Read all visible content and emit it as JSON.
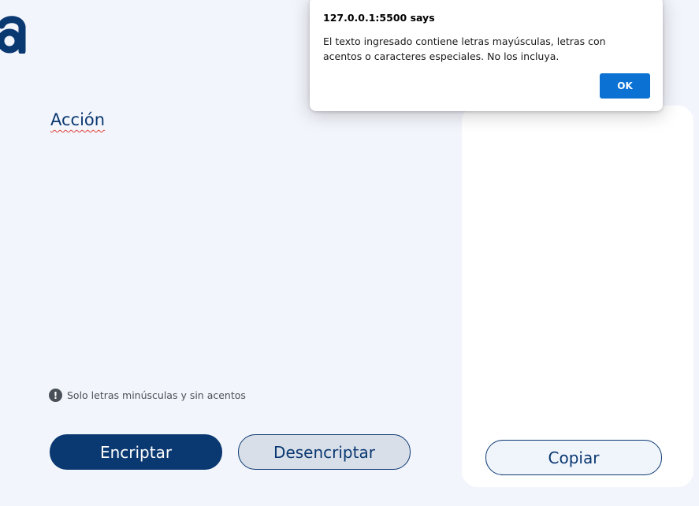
{
  "app": {
    "logo_icon": "alura-a-logo",
    "accent_color": "#0a3871"
  },
  "input": {
    "value": "Acción"
  },
  "hint": {
    "icon": "exclamation-circle-icon",
    "text": "Solo letras minúsculas y sin acentos"
  },
  "buttons": {
    "encrypt_label": "Encriptar",
    "decrypt_label": "Desencriptar",
    "copy_label": "Copiar"
  },
  "dialog": {
    "title": "127.0.0.1:5500 says",
    "message": "El texto ingresado contiene letras mayúsculas, letras con acentos o caracteres especiales. No los incluya.",
    "ok_label": "OK",
    "ok_color": "#0b72d4"
  }
}
